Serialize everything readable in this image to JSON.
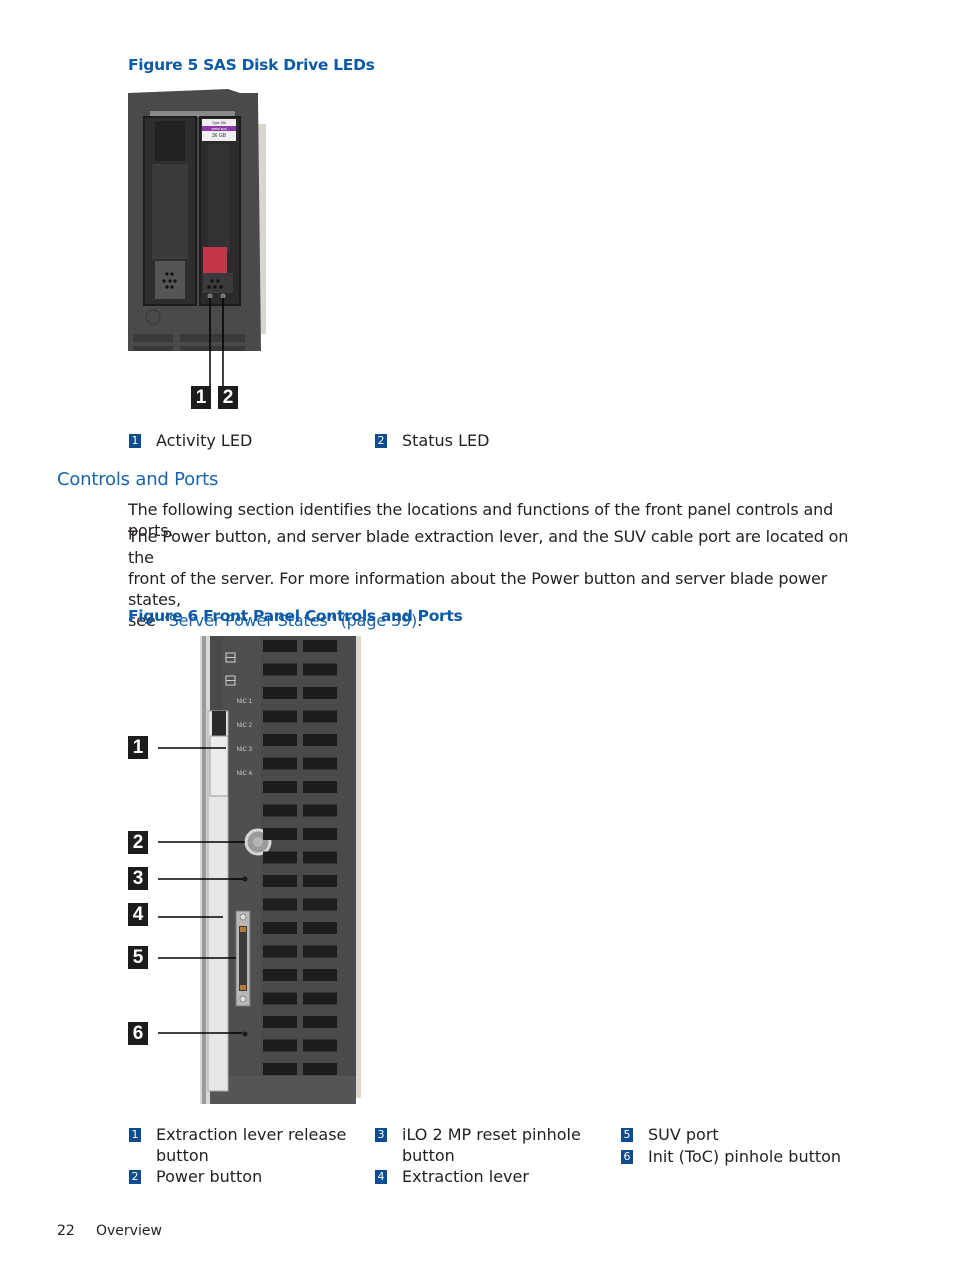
{
  "figure5": {
    "title": "Figure 5 SAS Disk Drive LEDs",
    "drive_label": {
      "line1": "Type 15k",
      "line2": "serial scsi",
      "line3": "36 GB"
    },
    "callouts": [
      "1",
      "2"
    ],
    "legend": [
      {
        "num": "1",
        "label": "Activity LED"
      },
      {
        "num": "2",
        "label": "Status LED"
      }
    ]
  },
  "section": {
    "heading": "Controls and Ports",
    "para1": "The following section identifies the locations and functions of the front panel controls and ports.",
    "para2_line1": "The Power button, and server blade extraction lever, and the SUV cable port are located on the",
    "para2_line2": "front of the server. For more information about the Power button and server blade power states,",
    "para2_line3_prefix": "see ",
    "para2_link": "“Server Power States” (page 39)",
    "para2_suffix": "."
  },
  "figure6": {
    "title": "Figure 6 Front Panel Controls and Ports",
    "panel_labels": [
      "NIC 1",
      "NIC 2",
      "NIC 3",
      "NIC 4"
    ],
    "callouts": [
      "1",
      "2",
      "3",
      "4",
      "5",
      "6"
    ],
    "legend": [
      {
        "num": "1",
        "label_line1": "Extraction lever release",
        "label_line2": "button"
      },
      {
        "num": "2",
        "label_line1": "Power button"
      },
      {
        "num": "3",
        "label_line1": "iLO 2 MP reset pinhole",
        "label_line2": "button"
      },
      {
        "num": "4",
        "label_line1": "Extraction lever"
      },
      {
        "num": "5",
        "label_line1": "SUV port"
      },
      {
        "num": "6",
        "label_line1": "Init (ToC) pinhole button"
      }
    ]
  },
  "footer": {
    "page_number": "22",
    "section_name": "Overview"
  },
  "colors": {
    "heading_blue": "#0d5aa7",
    "legend_box_blue": "#0e4d8f",
    "link_blue": "#1a64ad"
  }
}
